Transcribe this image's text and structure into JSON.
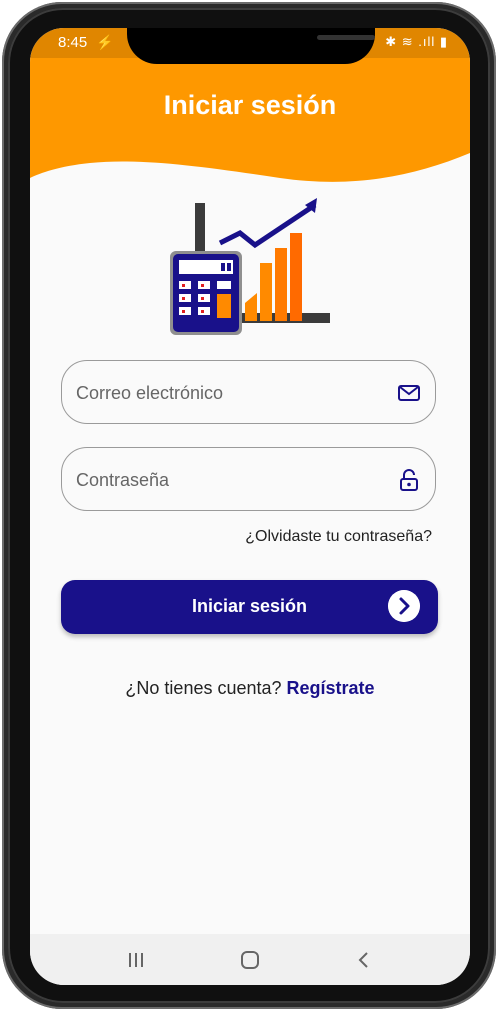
{
  "status_bar": {
    "time": "8:45",
    "right_icons": "✱ ≋ .ıll ▮"
  },
  "header": {
    "title": "Iniciar sesión"
  },
  "form": {
    "email_placeholder": "Correo electrónico",
    "password_placeholder": "Contraseña",
    "forgot_password": "¿Olvidaste tu contraseña?",
    "login_button": "Iniciar sesión"
  },
  "signup": {
    "prompt": "¿No tienes cuenta? ",
    "link": "Regístrate"
  },
  "icons": {
    "email": "mail-icon",
    "password": "unlock-icon",
    "login_arrow": "chevron-right-icon",
    "nav_recents": "recents-icon",
    "nav_home": "home-icon",
    "nav_back": "back-icon"
  },
  "colors": {
    "header_orange": "#fe9800",
    "primary_blue": "#19118a",
    "background": "#fafafa"
  }
}
